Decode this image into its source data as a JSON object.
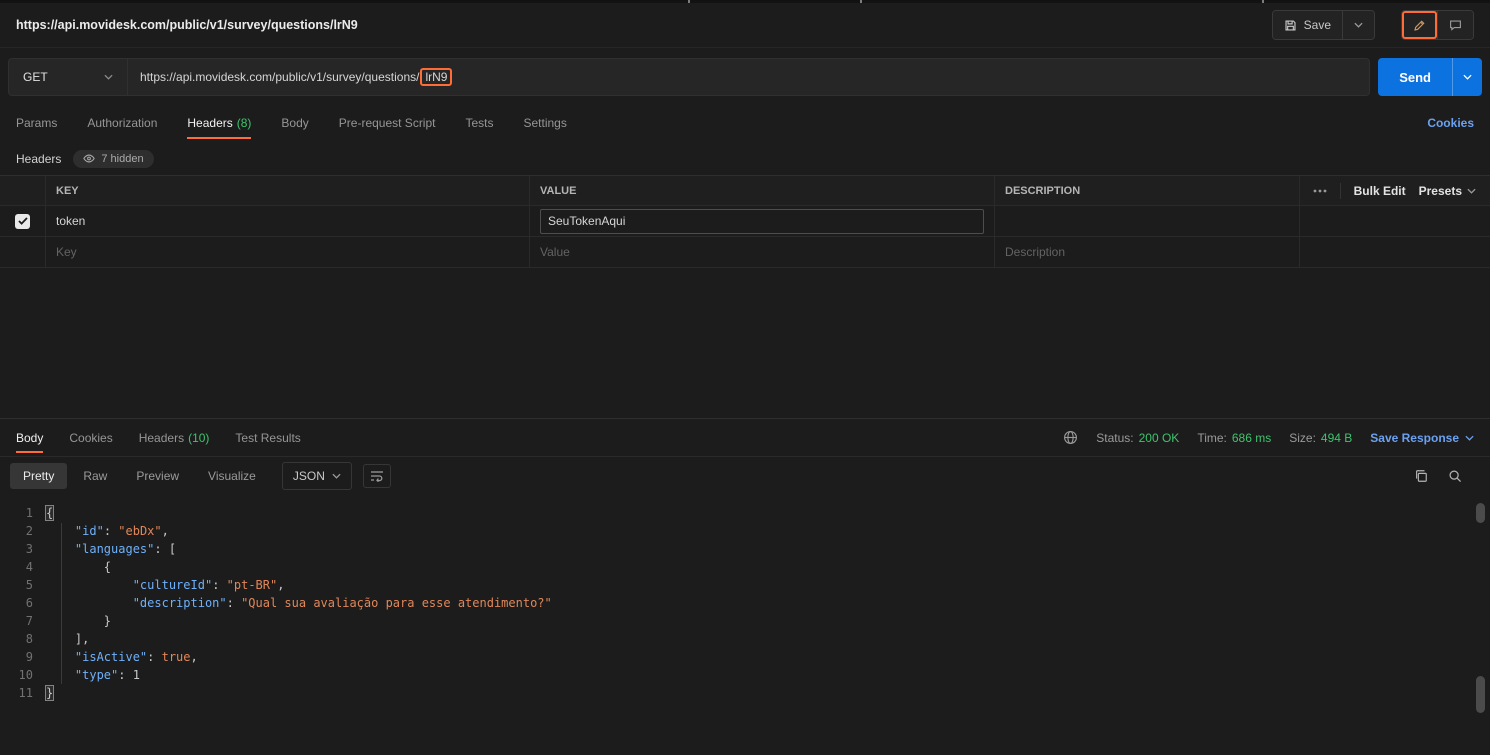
{
  "colors": {
    "accent_orange": "#ff6c37",
    "success_green": "#3ec46d",
    "send_blue": "#0c72e0",
    "link_blue": "#6ba1f0",
    "code_key_blue": "#6fb0f9",
    "code_string_orange": "#e0875a"
  },
  "titlebar": {
    "title": "https://api.movidesk.com/public/v1/survey/questions/lrN9",
    "save": "Save"
  },
  "request": {
    "method": "GET",
    "url_prefix": "https://api.movidesk.com/public/v1/survey/questions/",
    "url_highlight": "lrN9",
    "send": "Send"
  },
  "request_tabs": {
    "items": [
      {
        "label": "Params"
      },
      {
        "label": "Authorization"
      },
      {
        "label": "Headers",
        "count": "(8)"
      },
      {
        "label": "Body"
      },
      {
        "label": "Pre-request Script"
      },
      {
        "label": "Tests"
      },
      {
        "label": "Settings"
      }
    ],
    "cookies": "Cookies"
  },
  "headers_editor": {
    "title": "Headers",
    "hidden_badge": "7 hidden",
    "columns": [
      "KEY",
      "VALUE",
      "DESCRIPTION"
    ],
    "bulk_edit": "Bulk Edit",
    "presets": "Presets",
    "row": {
      "key": "token",
      "value": "SeuTokenAqui",
      "description": ""
    },
    "placeholders": {
      "key": "Key",
      "value": "Value",
      "description": "Description"
    }
  },
  "response": {
    "tabs": [
      {
        "label": "Body"
      },
      {
        "label": "Cookies"
      },
      {
        "label": "Headers",
        "count": "(10)"
      },
      {
        "label": "Test Results"
      }
    ],
    "status_label": "Status:",
    "status_value": "200 OK",
    "time_label": "Time:",
    "time_value": "686 ms",
    "size_label": "Size:",
    "size_value": "494 B",
    "save_response": "Save Response",
    "view_tabs": [
      "Pretty",
      "Raw",
      "Preview",
      "Visualize"
    ],
    "format": "JSON"
  },
  "code": {
    "lines": [
      {
        "n": "1",
        "i": 0,
        "t": [
          [
            "mb",
            "{"
          ]
        ]
      },
      {
        "n": "2",
        "i": 1,
        "t": [
          [
            "k",
            "\"id\""
          ],
          [
            "p",
            ": "
          ],
          [
            "s",
            "\"ebDx\""
          ],
          [
            "p",
            ","
          ]
        ]
      },
      {
        "n": "3",
        "i": 1,
        "t": [
          [
            "k",
            "\"languages\""
          ],
          [
            "p",
            ": ["
          ]
        ]
      },
      {
        "n": "4",
        "i": 2,
        "t": [
          [
            "p",
            "{"
          ]
        ]
      },
      {
        "n": "5",
        "i": 3,
        "t": [
          [
            "k",
            "\"cultureId\""
          ],
          [
            "p",
            ": "
          ],
          [
            "s",
            "\"pt-BR\""
          ],
          [
            "p",
            ","
          ]
        ]
      },
      {
        "n": "6",
        "i": 3,
        "t": [
          [
            "k",
            "\"description\""
          ],
          [
            "p",
            ": "
          ],
          [
            "s",
            "\"Qual sua avaliação para esse atendimento?\""
          ]
        ]
      },
      {
        "n": "7",
        "i": 2,
        "t": [
          [
            "p",
            "}"
          ]
        ]
      },
      {
        "n": "8",
        "i": 1,
        "t": [
          [
            "p",
            "],"
          ]
        ]
      },
      {
        "n": "9",
        "i": 1,
        "t": [
          [
            "k",
            "\"isActive\""
          ],
          [
            "p",
            ": "
          ],
          [
            "b",
            "true"
          ],
          [
            "p",
            ","
          ]
        ]
      },
      {
        "n": "10",
        "i": 1,
        "t": [
          [
            "k",
            "\"type\""
          ],
          [
            "p",
            ": "
          ],
          [
            "num",
            "1"
          ]
        ]
      },
      {
        "n": "11",
        "i": 0,
        "t": [
          [
            "mb",
            "}"
          ]
        ]
      }
    ]
  }
}
